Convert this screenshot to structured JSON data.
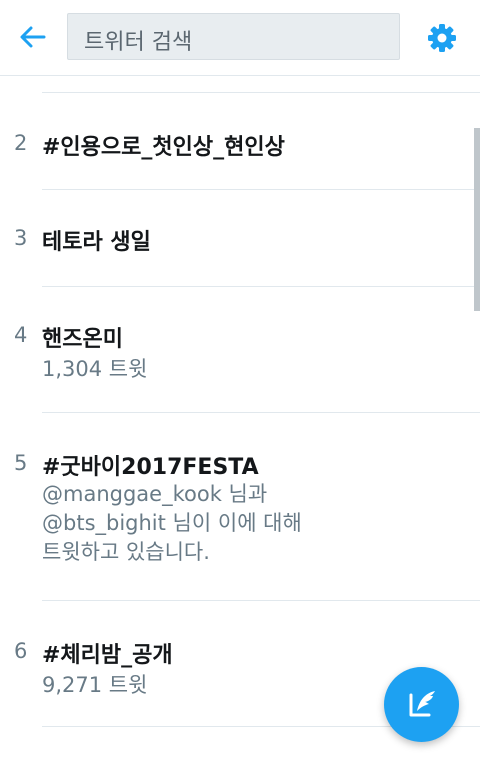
{
  "header": {
    "search_text": "트위터 검색",
    "accent": "#1da1f2"
  },
  "trends": [
    {
      "rank": "2",
      "name": "#인용으로_첫인상_현인상"
    },
    {
      "rank": "3",
      "name": "테토라 생일"
    },
    {
      "rank": "4",
      "name": "핸즈온미",
      "meta": "1,304 트윗"
    },
    {
      "rank": "5",
      "name": "#굿바이2017FESTA",
      "desc_lines": [
        "@manggae_kook 님과",
        "@bts_bighit 님이 이에 대해",
        "트윗하고 있습니다."
      ]
    },
    {
      "rank": "6",
      "name": "#체리밤_공개",
      "meta": "9,271 트윗"
    }
  ],
  "icons": {
    "back": "arrow-left-icon",
    "settings": "gear-icon",
    "compose": "compose-tweet-icon"
  }
}
